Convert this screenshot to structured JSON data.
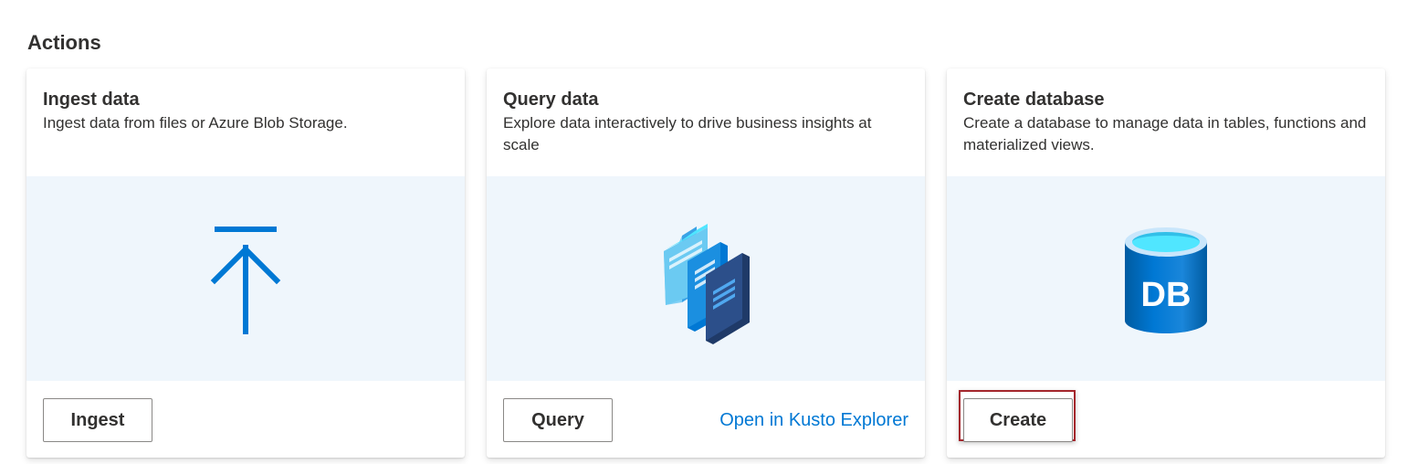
{
  "section": {
    "title": "Actions"
  },
  "cards": [
    {
      "title": "Ingest data",
      "description": "Ingest data from files or Azure Blob Storage.",
      "icon": "upload-arrow-icon",
      "button_label": "Ingest"
    },
    {
      "title": "Query data",
      "description": "Explore data interactively to drive business insights at scale",
      "icon": "query-documents-icon",
      "button_label": "Query",
      "link_label": "Open in Kusto Explorer"
    },
    {
      "title": "Create database",
      "description": "Create a database to manage data in tables, functions and materialized views.",
      "icon": "database-icon",
      "icon_text": "DB",
      "button_label": "Create"
    }
  ],
  "colors": {
    "accent": "#0078d4",
    "illustration_bg": "#eff6fc",
    "focus_outline": "#a4262c"
  }
}
